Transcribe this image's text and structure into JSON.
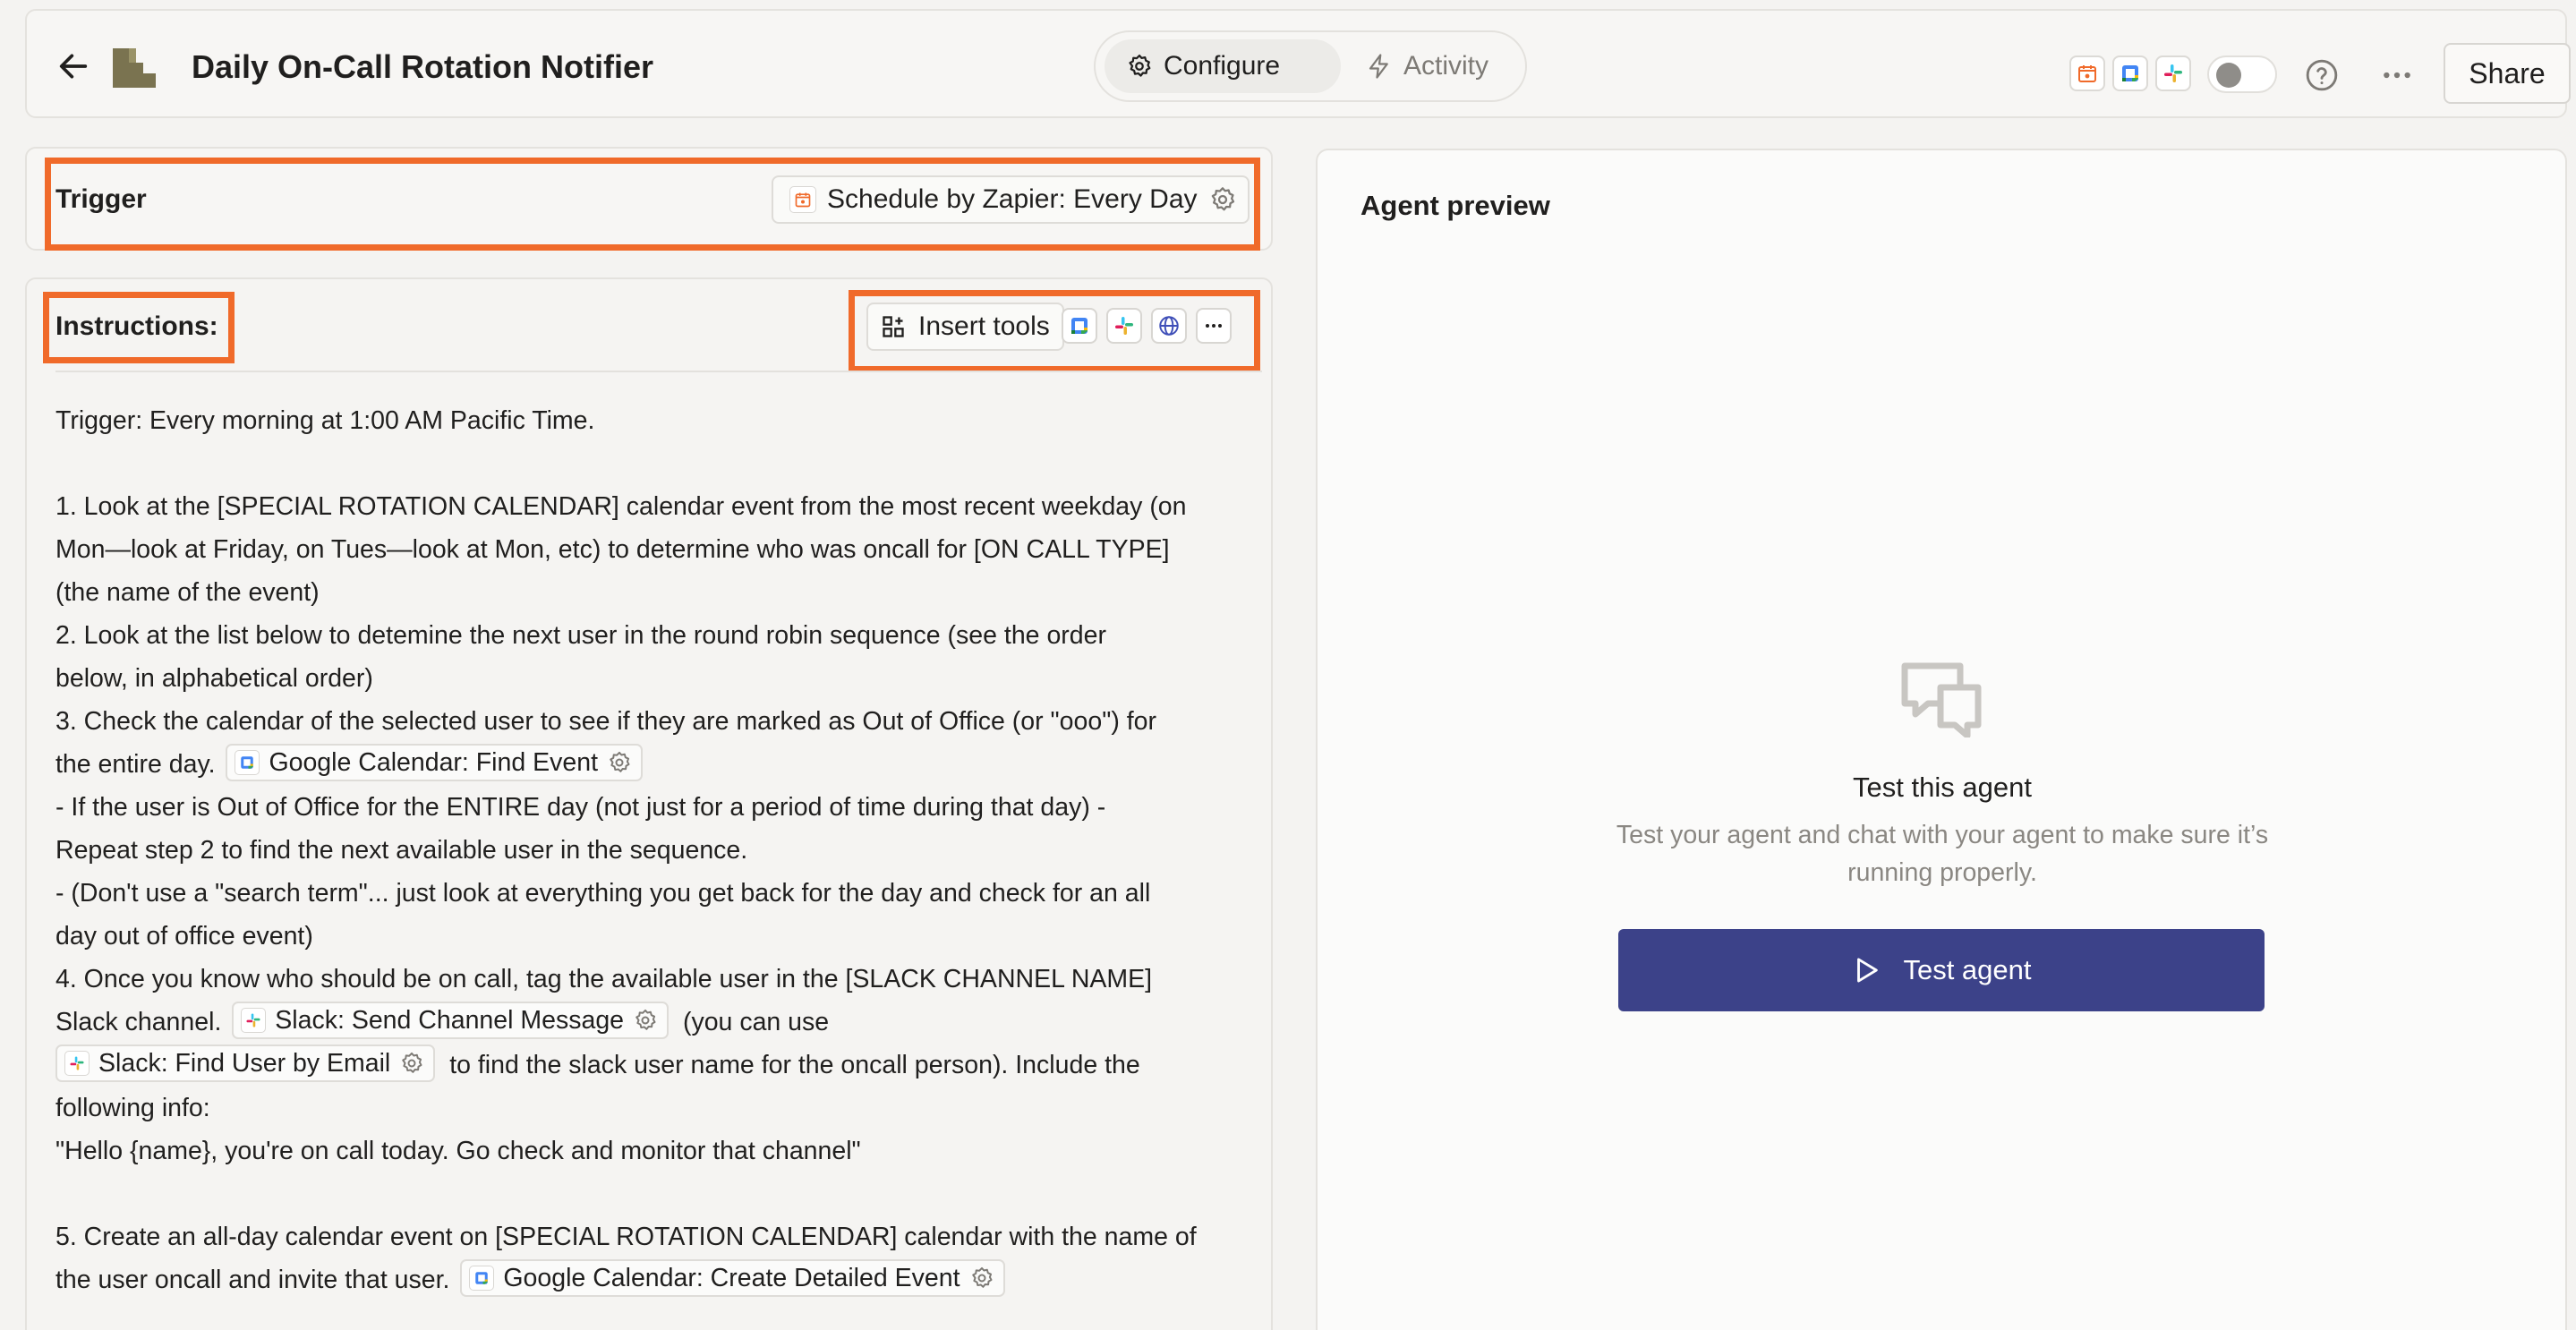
{
  "header": {
    "title": "Daily On-Call Rotation Notifier",
    "tabs": [
      {
        "label": "Configure",
        "active": true
      },
      {
        "label": "Activity",
        "active": false
      }
    ],
    "share_label": "Share",
    "connected_apps": [
      "schedule-icon",
      "google-calendar-icon",
      "slack-icon"
    ],
    "toggle_on": false
  },
  "trigger": {
    "label": "Trigger",
    "chip_label": "Schedule by Zapier: Every Day"
  },
  "instructions": {
    "label": "Instructions:",
    "insert_tools_label": "Insert tools",
    "tool_icons": [
      "google-calendar-icon",
      "slack-icon",
      "globe-icon",
      "more-icon"
    ],
    "lines": [
      "Trigger: Every morning at 1:00 AM Pacific Time.",
      "",
      "1. Look at the [SPECIAL ROTATION CALENDAR] calendar event from the most recent weekday (on",
      "Mon—look at Friday, on Tues—look at Mon, etc) to determine who was oncall for [ON CALL TYPE]",
      "(the name of the event)",
      "2. Look at the list below to detemine the next user in the round robin sequence (see the order",
      "below, in alphabetical order)",
      "3. Check the calendar of the selected user to see if they are marked as Out of Office (or \"ooo\") for",
      "the entire day.",
      "- If the user is Out of Office for the ENTIRE day (not just for a period of time during that day) -",
      "Repeat step 2 to find the next available user in the sequence.",
      "- (Don't use a \"search term\"... just look at everything you get back for the day and check for an all",
      "day out of office event)",
      "4. Once you know who should be on call, tag the available user in the [SLACK CHANNEL NAME]",
      "Slack channel.",
      "(you can use",
      "to find the slack user name for the oncall person). Include the",
      "following info:",
      "\"Hello {name}, you're on call today. Go check and monitor that channel\"",
      "",
      "5. Create an all-day calendar event on [SPECIAL ROTATION CALENDAR] calendar with the name of",
      "the user oncall and invite that user."
    ],
    "chips": {
      "find_event": "Google Calendar: Find Event",
      "send_message": "Slack: Send Channel Message",
      "find_user": "Slack: Find User by Email",
      "create_event": "Google Calendar: Create Detailed Event"
    }
  },
  "preview": {
    "title": "Agent preview",
    "empty_title": "Test this agent",
    "empty_desc": "Test your agent and chat with your agent to make sure it’s running properly.",
    "test_button": "Test agent"
  },
  "colors": {
    "highlight": "#f06a2a",
    "primary_button": "#3c4289",
    "logo": "#7a7350"
  }
}
